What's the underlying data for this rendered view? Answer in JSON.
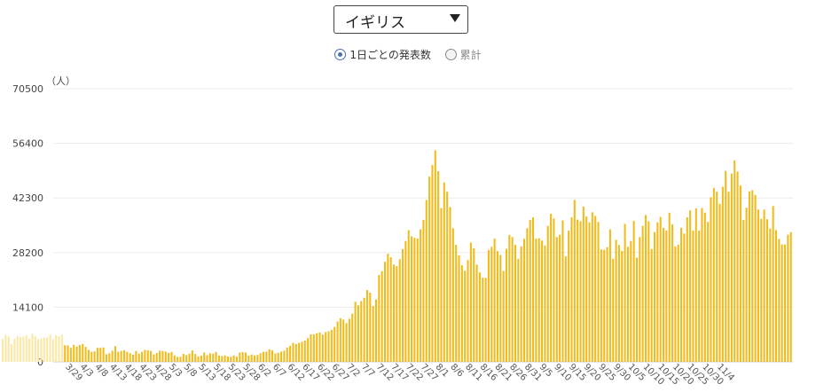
{
  "selector": {
    "value": "イギリス"
  },
  "mode": {
    "options": [
      {
        "label": "1日ごとの発表数",
        "checked": true
      },
      {
        "label": "累計",
        "checked": false
      }
    ]
  },
  "chart_data": {
    "type": "bar",
    "unit": "（人）",
    "ylim": [
      0,
      70500
    ],
    "y_ticks": [
      0,
      14100,
      28200,
      42300,
      56400,
      70500
    ],
    "x_tick_labels": [
      "3/29",
      "4/3",
      "4/8",
      "4/13",
      "4/18",
      "4/23",
      "4/28",
      "5/3",
      "5/8",
      "5/13",
      "5/18",
      "5/23",
      "5/28",
      "6/2",
      "6/7",
      "6/12",
      "6/17",
      "6/22",
      "6/27",
      "7/2",
      "7/7",
      "7/12",
      "7/17",
      "7/22",
      "7/27",
      "8/1",
      "8/6",
      "8/11",
      "8/16",
      "8/21",
      "8/26",
      "8/31",
      "9/5",
      "9/10",
      "9/15",
      "9/20",
      "9/25",
      "9/30",
      "10/5",
      "10/10",
      "10/15",
      "10/20",
      "10/25",
      "10/30",
      "11/4"
    ],
    "bar_color": "#f2bb1c",
    "faded_color": "#fbe7a6",
    "grid": true,
    "faded_count": 21,
    "values": [
      5940,
      6965,
      6550,
      4590,
      6023,
      6630,
      6430,
      6540,
      6810,
      6020,
      7235,
      6590,
      5795,
      5990,
      6285,
      6285,
      7010,
      5810,
      6870,
      6610,
      7020,
      4280,
      4230,
      3600,
      4410,
      3900,
      4360,
      4600,
      3850,
      3110,
      2590,
      2690,
      3620,
      3620,
      3710,
      1960,
      2210,
      2870,
      4050,
      2600,
      2820,
      2970,
      2570,
      2230,
      1850,
      2790,
      2090,
      2580,
      3100,
      2960,
      2810,
      1930,
      2280,
      2890,
      2820,
      2640,
      2330,
      2530,
      1650,
      1290,
      1300,
      2050,
      1760,
      2080,
      2950,
      2030,
      1400,
      1620,
      2430,
      1700,
      2220,
      2080,
      2550,
      1620,
      1500,
      1670,
      1360,
      1300,
      1660,
      1360,
      2380,
      2540,
      2400,
      1620,
      1880,
      1650,
      1780,
      2230,
      2580,
      2620,
      3230,
      3000,
      2140,
      2340,
      2620,
      2880,
      3700,
      4150,
      4870,
      4620,
      4900,
      5200,
      5500,
      6140,
      7100,
      7110,
      7370,
      7580,
      7030,
      7700,
      7900,
      8250,
      9020,
      10420,
      11270,
      10900,
      9990,
      11120,
      12450,
      15500,
      14600,
      15700,
      16540,
      18530,
      17860,
      14400,
      16140,
      22420,
      23420,
      25850,
      27900,
      27000,
      25100,
      24700,
      26480,
      29100,
      31200,
      34000,
      32400,
      32000,
      31800,
      34200,
      36600,
      41800,
      47800,
      50800,
      54600,
      49200,
      39700,
      46300,
      43900,
      39960,
      34500,
      30200,
      27500,
      24950,
      23500,
      26280,
      30800,
      29300,
      25100,
      23100,
      21720,
      21700,
      28860,
      29700,
      31800,
      28580,
      27600,
      23490,
      29170,
      32760,
      32210,
      30220,
      26600,
      29800,
      31750,
      34500,
      36600,
      37300,
      31800,
      31900,
      31300,
      30000,
      35100,
      38200,
      37000,
      32200,
      32800,
      36500,
      27260,
      33900,
      37300,
      41800,
      36700,
      36300,
      40100,
      37500,
      35990,
      38600,
      37680,
      36100,
      29000,
      28900,
      29600,
      34200,
      26600,
      31500,
      30140,
      28600,
      35600,
      29700,
      31200,
      36400,
      26900,
      32200,
      35100,
      37900,
      36300,
      29100,
      33500,
      36000,
      37400,
      34600,
      33900,
      38500,
      35500,
      29800,
      30250,
      34600,
      33100,
      37300,
      39100,
      33900,
      39600,
      33900,
      39700,
      38500,
      36100,
      42500,
      44900,
      43900,
      40800,
      45200,
      49300,
      43900,
      48600,
      52000,
      49100,
      45500,
      36600,
      39800,
      44000,
      44300,
      43100,
      39300,
      36900,
      39300,
      36800,
      34400,
      40200,
      34000,
      31700,
      30300,
      30300,
      32800,
      33500
    ]
  }
}
